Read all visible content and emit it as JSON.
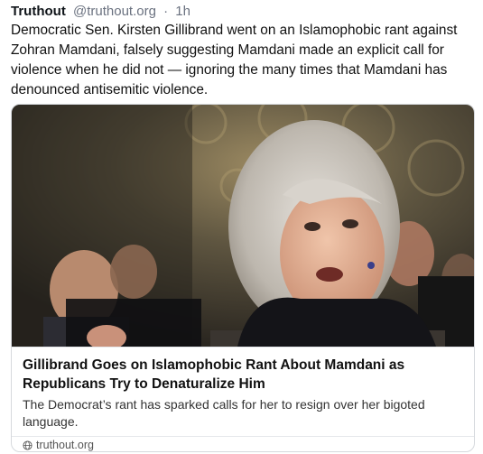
{
  "post": {
    "author": "Truthout",
    "handle": "@truthout.org",
    "separator": "·",
    "time": "1h",
    "text": "Democratic Sen. Kirsten Gillibrand went on an Islamophobic rant against Zohran Mamdani, falsely suggesting Mamdani made an explicit call for violence when he did not — ignoring the many times that Mamdani has denounced antisemitic violence."
  },
  "link_card": {
    "image_subject": "photo of Sen. Kirsten Gillibrand speaking at a hearing",
    "title": "Gillibrand Goes on Islamophobic Rant About Mamdani as Republicans Try to Denaturalize Him",
    "description": "The Democrat’s rant has sparked calls for her to resign over her bigoted language.",
    "domain": "truthout.org",
    "domain_icon": "globe-icon"
  },
  "colors": {
    "text": "#111111",
    "muted": "#6b7280",
    "card_border": "#d6d9dd"
  }
}
